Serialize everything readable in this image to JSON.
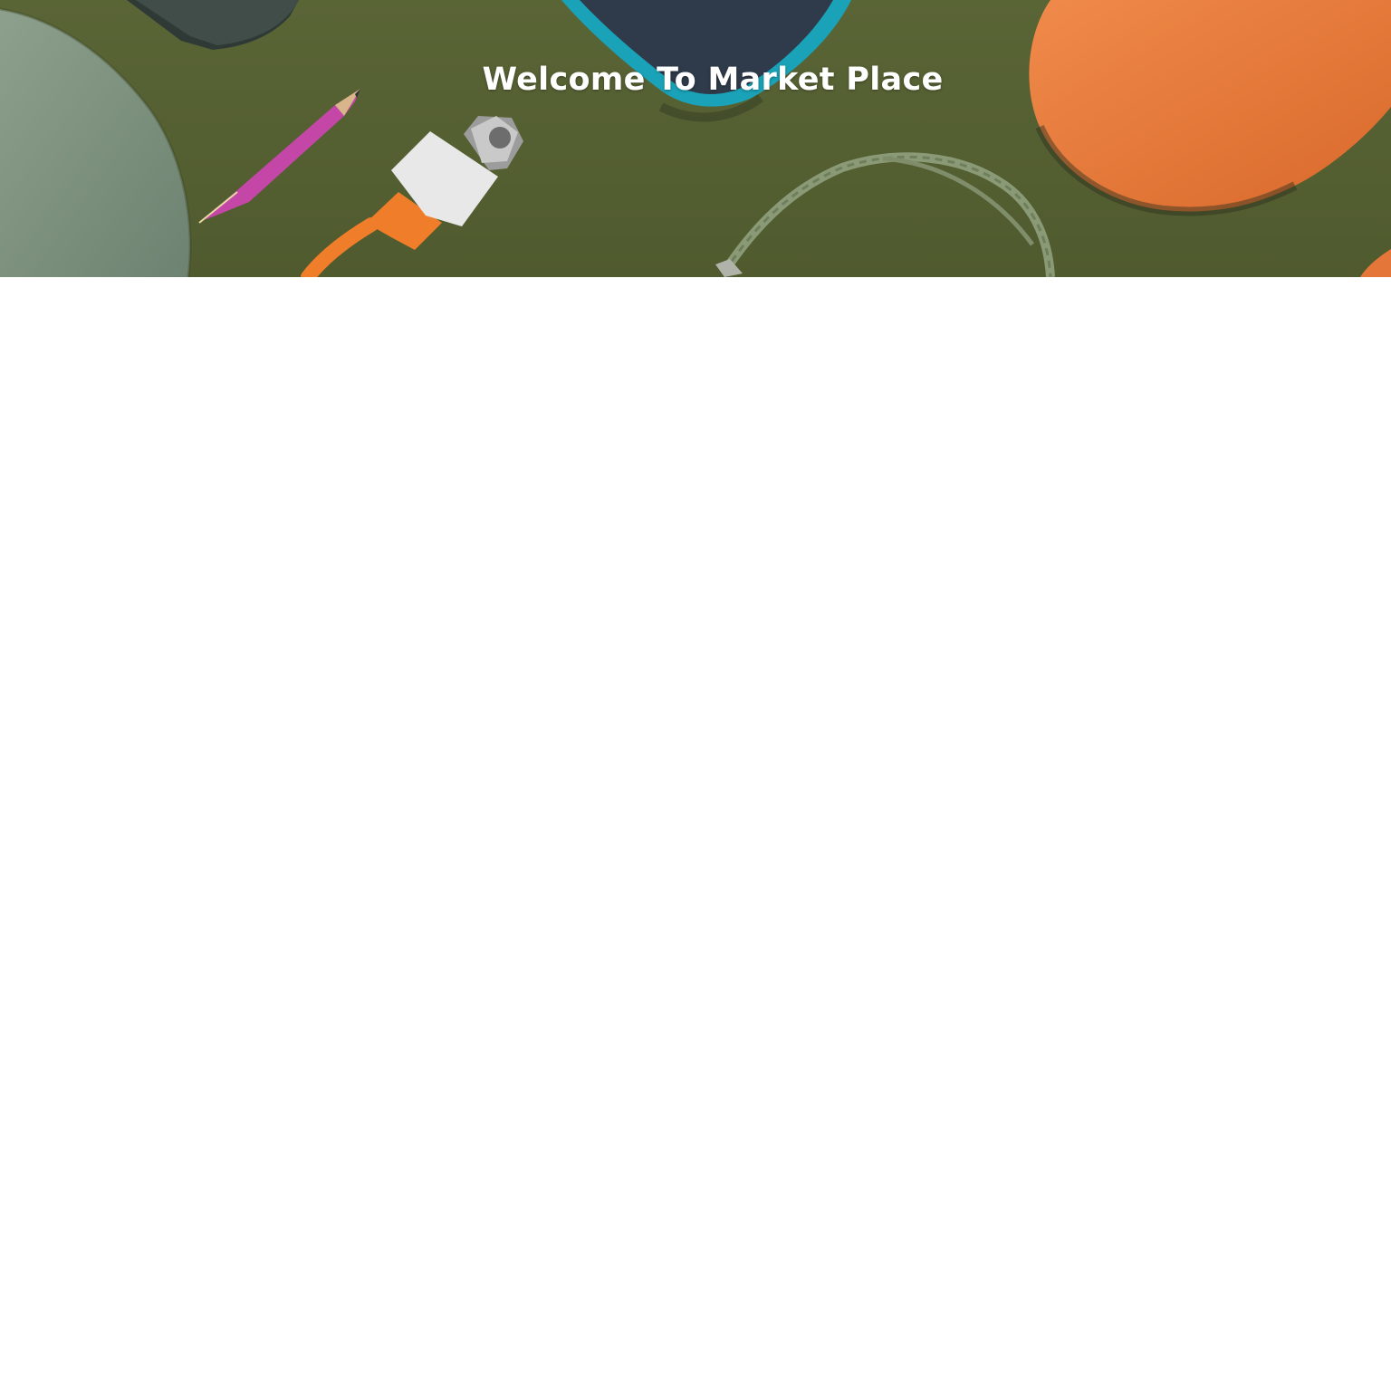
{
  "hero": {
    "title": "Welcome To Market Place",
    "background_color": "#556033"
  },
  "icons": {
    "hero_image": "hero-banner-image"
  },
  "colors": {
    "page_background": "#ffffff",
    "title_text": "#ffffff"
  }
}
